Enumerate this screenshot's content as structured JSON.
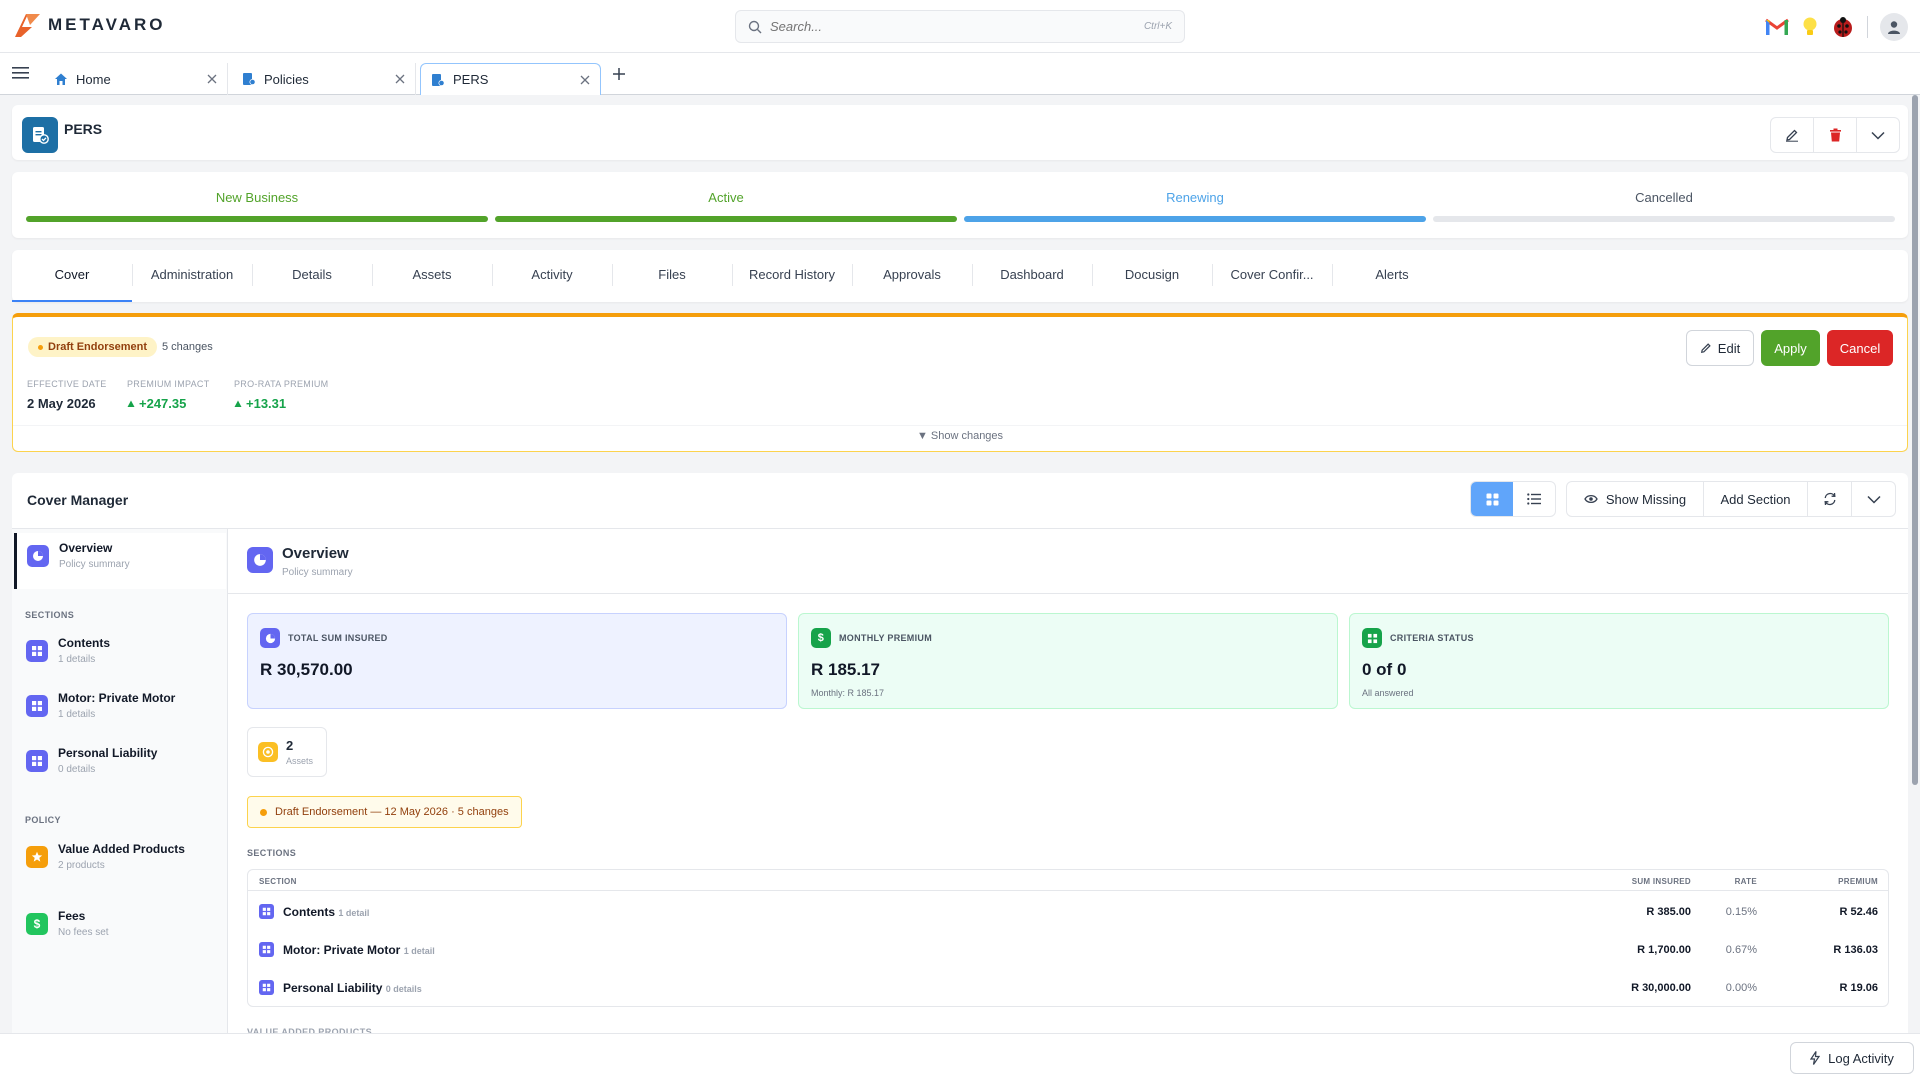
{
  "app": {
    "brand": "METAVARO"
  },
  "search": {
    "placeholder": "Search...",
    "shortcut": "Ctrl+K"
  },
  "colors": {
    "brand_orange": "#e8622a",
    "success": "#52a32a",
    "danger": "#dc2626",
    "info": "#4da3e8",
    "warning": "#f59e0b",
    "accent_indigo": "#6366f1"
  },
  "tabs": [
    {
      "label": "Home",
      "icon": "home-icon"
    },
    {
      "label": "Policies",
      "icon": "policy-icon"
    },
    {
      "label": "PERS",
      "icon": "policy-icon"
    }
  ],
  "page": {
    "title": "PERS"
  },
  "stages": [
    {
      "label": "New Business",
      "status": "complete"
    },
    {
      "label": "Active",
      "status": "complete"
    },
    {
      "label": "Renewing",
      "status": "current"
    },
    {
      "label": "Cancelled",
      "status": "pending"
    }
  ],
  "subtabs": [
    "Cover",
    "Administration",
    "Details",
    "Assets",
    "Activity",
    "Files",
    "Record History",
    "Approvals",
    "Dashboard",
    "Docusign",
    "Cover Confir...",
    "Alerts"
  ],
  "draft": {
    "badge": "Draft Endorsement",
    "changes": "5 changes",
    "effective_label": "EFFECTIVE DATE",
    "effective_value": "2 May 2026",
    "impact_label": "PREMIUM IMPACT",
    "impact_value": "+247.35",
    "prorata_label": "PRO-RATA PREMIUM",
    "prorata_value": "+13.31",
    "edit": "Edit",
    "apply": "Apply",
    "cancel": "Cancel",
    "show_changes": "▼ Show changes"
  },
  "cover": {
    "title": "Cover Manager",
    "show_missing": "Show Missing",
    "add_section": "Add Section"
  },
  "nav": {
    "overview": {
      "title": "Overview",
      "sub": "Policy summary"
    },
    "sections_head": "SECTIONS",
    "sections": [
      {
        "title": "Contents",
        "sub": "1 details"
      },
      {
        "title": "Motor: Private Motor",
        "sub": "1 details"
      },
      {
        "title": "Personal Liability",
        "sub": "0 details"
      }
    ],
    "policy_head": "POLICY",
    "policy": [
      {
        "title": "Value Added Products",
        "sub": "2 products"
      },
      {
        "title": "Fees",
        "sub": "No fees set"
      }
    ]
  },
  "overview": {
    "title": "Overview",
    "sub": "Policy summary",
    "stats": [
      {
        "label": "TOTAL SUM INSURED",
        "value": "R 30,570.00",
        "sub": ""
      },
      {
        "label": "MONTHLY PREMIUM",
        "value": "R 185.17",
        "sub": "Monthly: R 185.17"
      },
      {
        "label": "CRITERIA STATUS",
        "value": "0 of 0",
        "sub": "All answered"
      }
    ],
    "assets_count": "2",
    "assets_label": "Assets",
    "draft_pill": "Draft Endorsement — 12 May 2026 · 5 changes",
    "sections_head": "SECTIONS",
    "vap_head": "VALUE ADDED PRODUCTS"
  },
  "sections_table": {
    "headers": [
      "SECTION",
      "SUM INSURED",
      "RATE",
      "PREMIUM"
    ],
    "rows": [
      {
        "name": "Contents",
        "detail": "1 detail",
        "sum": "R 385.00",
        "rate": "0.15%",
        "premium": "R 52.46"
      },
      {
        "name": "Motor: Private Motor",
        "detail": "1 detail",
        "sum": "R 1,700.00",
        "rate": "0.67%",
        "premium": "R 136.03"
      },
      {
        "name": "Personal Liability",
        "detail": "0 details",
        "sum": "R 30,000.00",
        "rate": "0.00%",
        "premium": "R 19.06"
      }
    ]
  },
  "footer": {
    "log_activity": "Log Activity"
  }
}
